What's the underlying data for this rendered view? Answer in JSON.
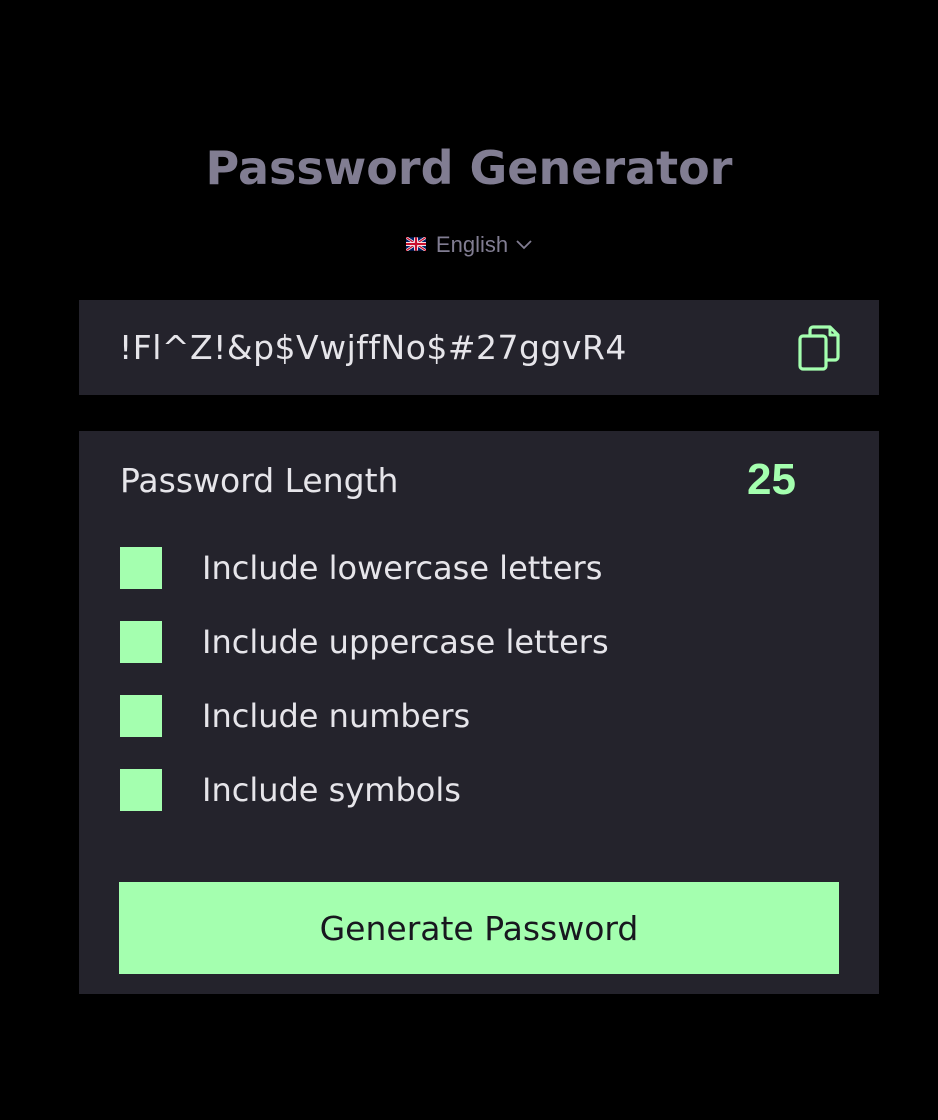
{
  "header": {
    "title": "Password Generator"
  },
  "language": {
    "selected": "English",
    "flag_icon": "uk-flag-icon",
    "chevron_icon": "chevron-down-icon"
  },
  "output": {
    "password": "!Fl^Z!&p$VwjffNo$#27ggvR4",
    "copy_icon": "copy-icon"
  },
  "settings": {
    "length_label": "Password Length",
    "length_value": "25",
    "options": [
      {
        "label": "Include lowercase letters",
        "checked": true
      },
      {
        "label": "Include uppercase letters",
        "checked": true
      },
      {
        "label": "Include numbers",
        "checked": true
      },
      {
        "label": "Include symbols",
        "checked": true
      }
    ],
    "generate_label": "Generate Password"
  },
  "colors": {
    "background": "#000000",
    "panel": "#24232c",
    "accent": "#a4ffaf",
    "text": "#e6e5ea",
    "muted": "#817d92"
  }
}
